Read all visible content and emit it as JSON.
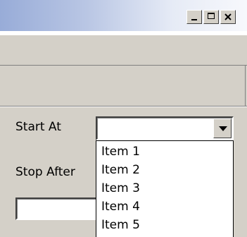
{
  "window": {
    "title_buttons": {
      "minimize_icon": "minimize-icon",
      "maximize_icon": "maximize-icon",
      "close_icon": "close-icon"
    }
  },
  "form": {
    "start_at_label": "Start At",
    "start_at_value": "",
    "stop_after_label": "Stop After",
    "stop_after_value": ""
  },
  "dropdown": {
    "items": [
      "Item 1",
      "Item 2",
      "Item 3",
      "Item 4",
      "Item 5"
    ]
  },
  "colors": {
    "face": "#d4d0c8",
    "title_gradient_start": "#98acd8",
    "title_gradient_end": "#f7f8fc"
  }
}
